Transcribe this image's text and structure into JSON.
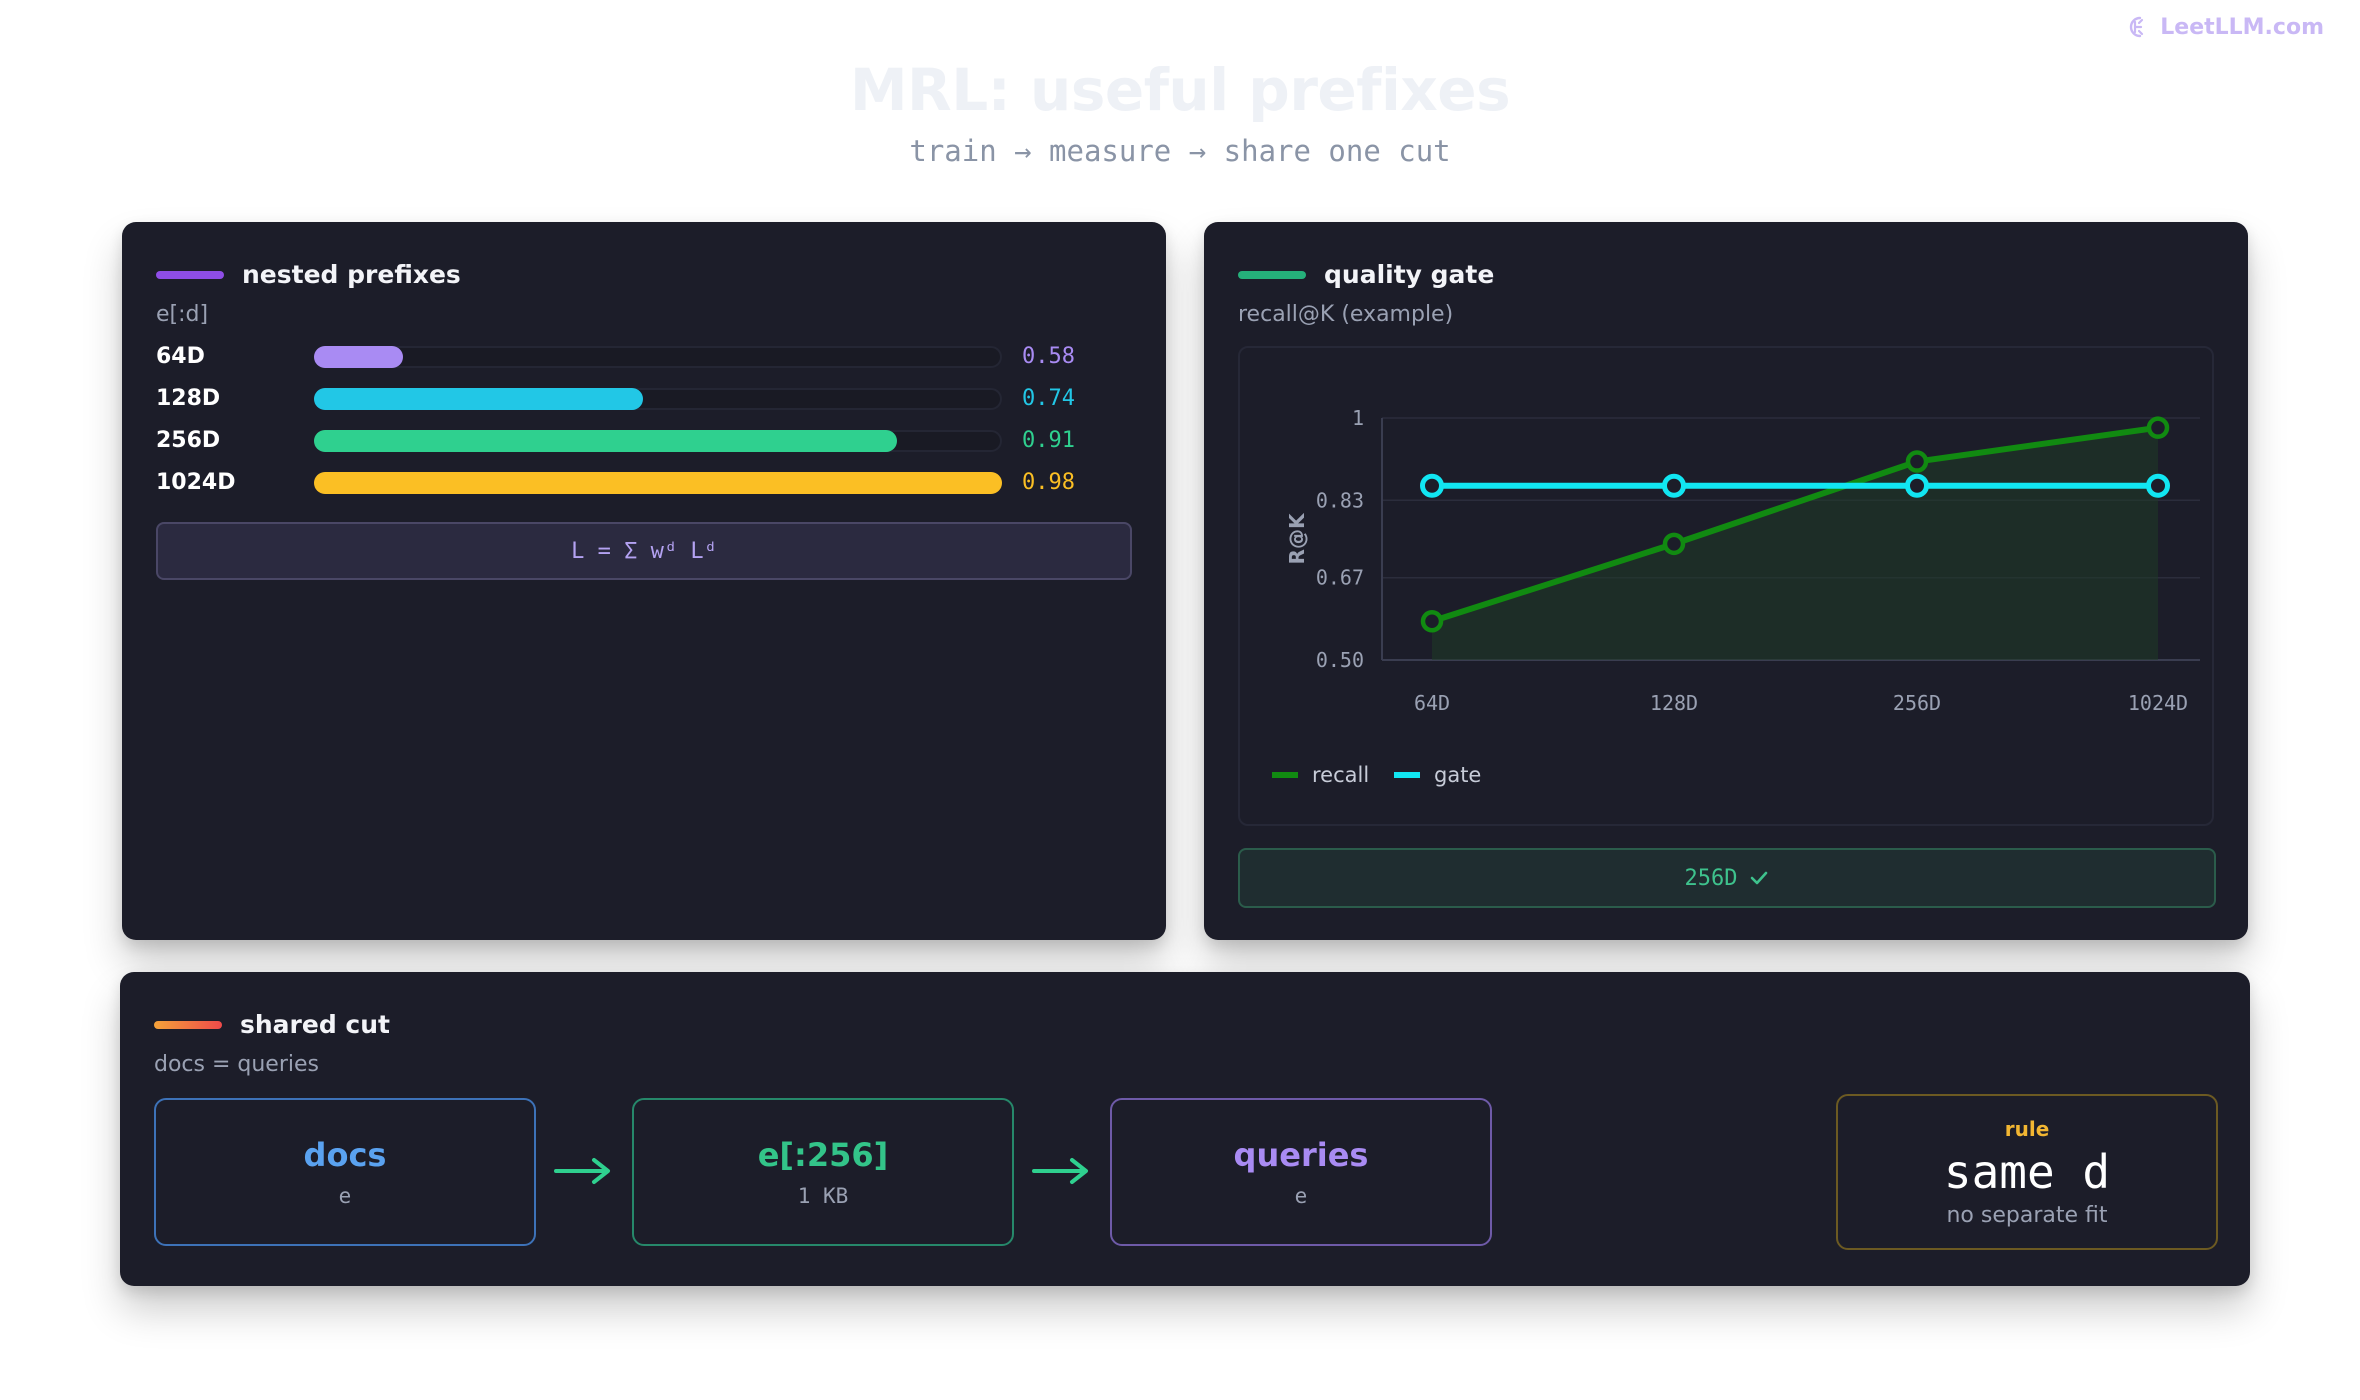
{
  "brand": {
    "name": "LeetLLM.com",
    "color": "#c9b8f5"
  },
  "title": "MRL: useful prefixes",
  "subtitle": "train → measure → share one cut",
  "prefixes_panel": {
    "title": "nested prefixes",
    "subtitle": "e[:d]",
    "accent": "#8e4de6",
    "rows": [
      {
        "label": "64D",
        "value": 0.58,
        "display": "0.58",
        "color": "#a98bf3"
      },
      {
        "label": "128D",
        "value": 0.74,
        "display": "0.74",
        "color": "#22c7e6"
      },
      {
        "label": "256D",
        "value": 0.91,
        "display": "0.91",
        "color": "#2fd08f"
      },
      {
        "label": "1024D",
        "value": 0.98,
        "display": "0.98",
        "color": "#fbbf24"
      }
    ],
    "formula": "L = Σ wᵈ Lᵈ"
  },
  "gate_panel": {
    "title": "quality gate",
    "subtitle": "recall@K (example)",
    "accent": "#25b07a",
    "badge_text": "256D",
    "badge_icon": "check-icon"
  },
  "chart_data": {
    "type": "line",
    "categories": [
      "64D",
      "128D",
      "256D",
      "1024D"
    ],
    "series": [
      {
        "name": "recall",
        "values": [
          0.58,
          0.74,
          0.91,
          0.98
        ],
        "color": "#118a11"
      },
      {
        "name": "gate",
        "values": [
          0.86,
          0.86,
          0.86,
          0.86
        ],
        "color": "#11e6f2"
      }
    ],
    "ylabel": "R@K",
    "yticks": [
      {
        "value": 0.5,
        "label": "0.50"
      },
      {
        "value": 0.67,
        "label": "0.67"
      },
      {
        "value": 0.83,
        "label": "0.83"
      },
      {
        "value": 1.0,
        "label": "1"
      }
    ],
    "ylim": [
      0.5,
      1.0
    ],
    "grid": true,
    "legend": "bottom-left"
  },
  "shared_panel": {
    "title": "shared cut",
    "subtitle": "docs = queries",
    "accent_from": "#f4a23a",
    "accent_to": "#ef4a4a",
    "flow": [
      {
        "name": "docs",
        "detail": "e",
        "color": "#5aa2f0",
        "border": "#3d72b8"
      },
      {
        "name": "e[:256]",
        "detail": "1 KB",
        "color": "#33c489",
        "border": "#26886a"
      },
      {
        "name": "queries",
        "detail": "e",
        "color": "#a98bf3",
        "border": "#6e5aa8"
      }
    ],
    "arrow_color": "#2fd08f",
    "rule": {
      "kicker": "rule",
      "value": "same d",
      "note": "no separate fit"
    }
  }
}
